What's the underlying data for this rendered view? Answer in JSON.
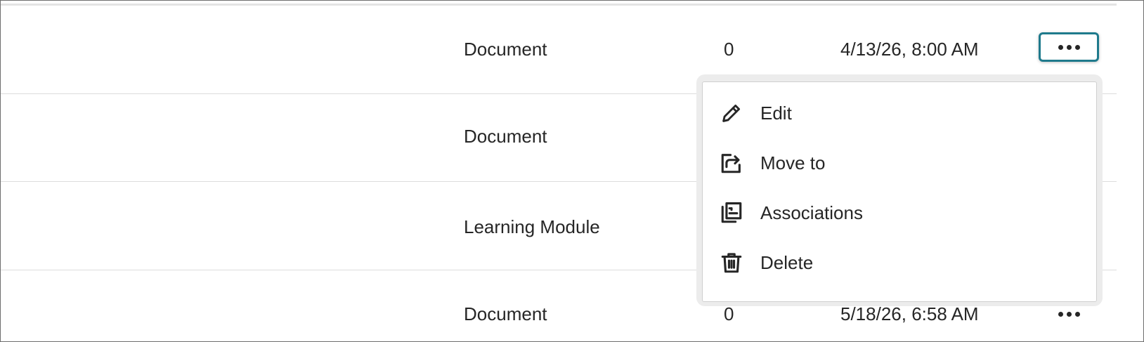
{
  "rows": [
    {
      "type": "Document",
      "count": "0",
      "date": "4/13/26, 8:00 AM"
    },
    {
      "type": "Document",
      "count": "",
      "date": ""
    },
    {
      "type": "Learning Module",
      "count": "",
      "date": ""
    },
    {
      "type": "Document",
      "count": "0",
      "date": "5/18/26, 6:58 AM"
    }
  ],
  "row_actions": {
    "more_icon": "more-horizontal-icon"
  },
  "menu": {
    "items": [
      {
        "label": "Edit",
        "icon": "pencil-icon"
      },
      {
        "label": "Move to",
        "icon": "move-to-icon"
      },
      {
        "label": "Associations",
        "icon": "associations-icon"
      },
      {
        "label": "Delete",
        "icon": "trash-icon"
      }
    ]
  },
  "colors": {
    "focus_ring": "#1f7a8c",
    "text": "#262626",
    "divider": "#dcdcdc"
  }
}
